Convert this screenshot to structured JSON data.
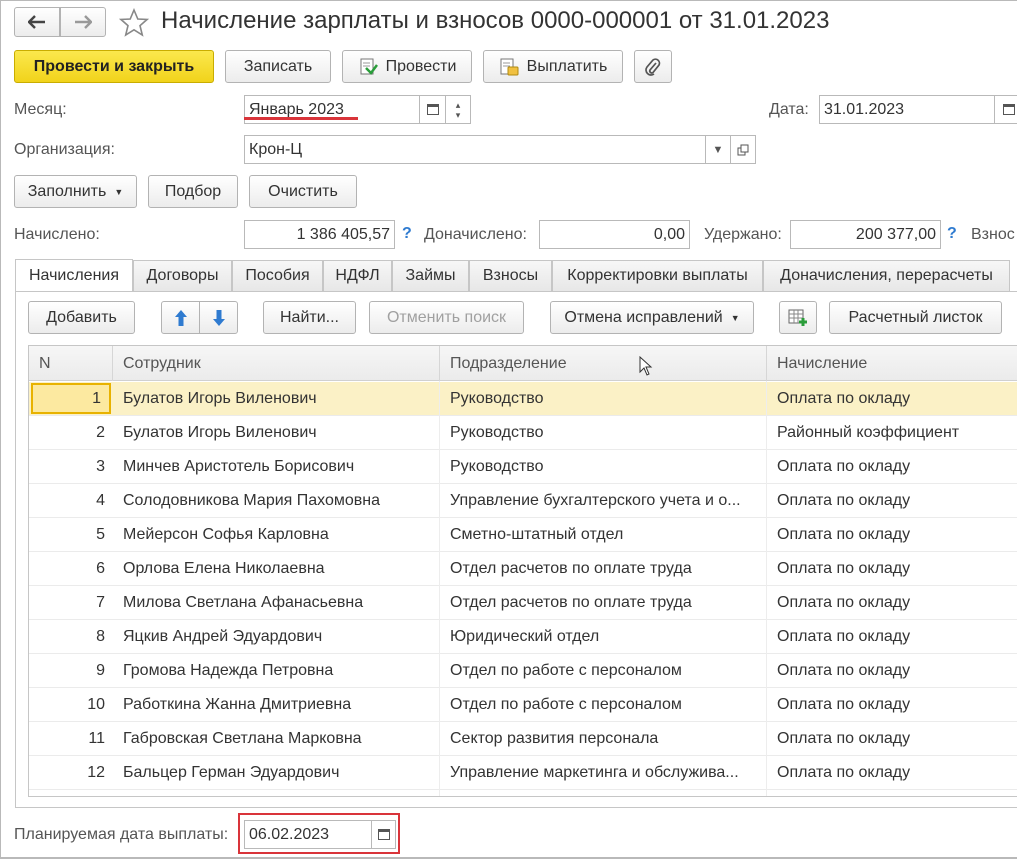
{
  "window": {
    "title": "Начисление зарплаты и взносов 0000-000001 от 31.01.2023"
  },
  "toolbar": {
    "post_close": "Провести и закрыть",
    "save": "Записать",
    "post": "Провести",
    "pay": "Выплатить"
  },
  "header": {
    "month_label": "Месяц:",
    "month_value": "Январь 2023",
    "date_label": "Дата:",
    "date_value": "31.01.2023",
    "org_label": "Организация:",
    "org_value": "Крон-Ц"
  },
  "actions": {
    "fill": "Заполнить",
    "select": "Подбор",
    "clear": "Очистить"
  },
  "totals": {
    "accrued_label": "Начислено:",
    "accrued_value": "1 386 405,57",
    "additional_label": "Доначислено:",
    "additional_value": "0,00",
    "withheld_label": "Удержано:",
    "withheld_value": "200 377,00",
    "contrib_label": "Взнос",
    "help": "?"
  },
  "tabs": [
    {
      "label": "Начисления"
    },
    {
      "label": "Договоры"
    },
    {
      "label": "Пособия"
    },
    {
      "label": "НДФЛ"
    },
    {
      "label": "Займы"
    },
    {
      "label": "Взносы"
    },
    {
      "label": "Корректировки выплаты"
    },
    {
      "label": "Доначисления, перерасчеты"
    }
  ],
  "table_toolbar": {
    "add": "Добавить",
    "find": "Найти...",
    "cancel_search": "Отменить поиск",
    "cancel_corrections": "Отмена исправлений",
    "payslip": "Расчетный листок"
  },
  "table": {
    "columns": [
      "N",
      "Сотрудник",
      "Подразделение",
      "Начисление"
    ],
    "rows": [
      {
        "n": "1",
        "employee": "Булатов Игорь Виленович",
        "dept": "Руководство",
        "accrual": "Оплата по окладу"
      },
      {
        "n": "2",
        "employee": "Булатов Игорь Виленович",
        "dept": "Руководство",
        "accrual": "Районный коэффициент"
      },
      {
        "n": "3",
        "employee": "Минчев Аристотель Борисович",
        "dept": "Руководство",
        "accrual": "Оплата по окладу"
      },
      {
        "n": "4",
        "employee": "Солодовникова Мария Пахомовна",
        "dept": "Управление бухгалтерского учета и о...",
        "accrual": "Оплата по окладу"
      },
      {
        "n": "5",
        "employee": "Мейерсон Софья Карловна",
        "dept": "Сметно-штатный отдел",
        "accrual": "Оплата по окладу"
      },
      {
        "n": "6",
        "employee": "Орлова Елена Николаевна",
        "dept": "Отдел расчетов по оплате труда",
        "accrual": "Оплата по окладу"
      },
      {
        "n": "7",
        "employee": "Милова Светлана Афанасьевна",
        "dept": "Отдел расчетов по оплате труда",
        "accrual": "Оплата по окладу"
      },
      {
        "n": "8",
        "employee": "Яцкив Андрей Эдуардович",
        "dept": "Юридический отдел",
        "accrual": "Оплата по окладу"
      },
      {
        "n": "9",
        "employee": "Громова Надежда Петровна",
        "dept": "Отдел по работе с персоналом",
        "accrual": "Оплата по окладу"
      },
      {
        "n": "10",
        "employee": "Работкина Жанна Дмитриевна",
        "dept": "Отдел по работе с персоналом",
        "accrual": "Оплата по окладу"
      },
      {
        "n": "11",
        "employee": "Габровская Светлана Марковна",
        "dept": "Сектор развития персонала",
        "accrual": "Оплата по окладу"
      },
      {
        "n": "12",
        "employee": "Бальцер Герман Эдуардович",
        "dept": "Управление маркетинга и обслужива...",
        "accrual": "Оплата по окладу"
      }
    ]
  },
  "footer": {
    "pay_date_label": "Планируемая дата выплаты:",
    "pay_date_value": "06.02.2023"
  },
  "colors": {
    "primary_button": "#f1d31b",
    "selected_row": "#fbf1c6",
    "highlight_red": "#d9343a",
    "help_blue": "#2f7bd0"
  }
}
